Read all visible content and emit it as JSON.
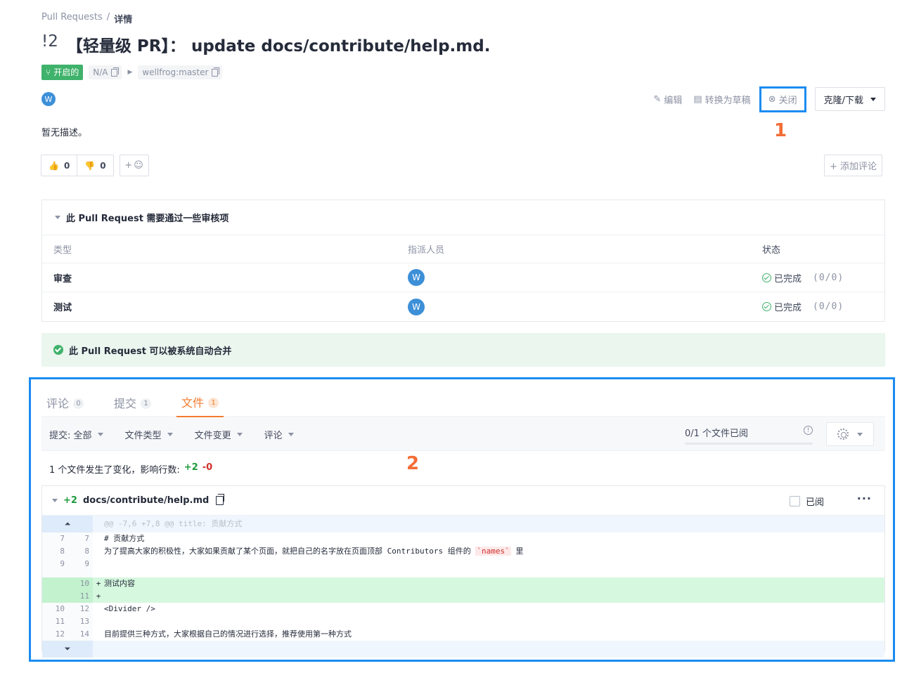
{
  "breadcrumb": {
    "root": "Pull Requests",
    "sep": "/",
    "current": "详情"
  },
  "pr": {
    "number": "!2",
    "title": "【轻量级 PR】： update docs/contribute/help.md.",
    "status": "开启的",
    "source_branch": "N/A",
    "target_branch": "wellfrog:master",
    "author_initial": "W",
    "description": "暂无描述。"
  },
  "actions": {
    "edit": "编辑",
    "draft": "转换为草稿",
    "close": "关闭",
    "clone": "克隆/下载"
  },
  "annotations": {
    "one": "1",
    "two": "2"
  },
  "reactions": {
    "thumbs_up": "0",
    "thumbs_down": "0",
    "add_emoji": "+",
    "add_comment": "+ 添加评论"
  },
  "review": {
    "heading": "此 Pull Request 需要通过一些审核项",
    "columns": [
      "类型",
      "指派人员",
      "状态"
    ],
    "rows": [
      {
        "type": "审查",
        "assignee": "W",
        "status": "已完成",
        "count": "(0/0)"
      },
      {
        "type": "测试",
        "assignee": "W",
        "status": "已完成",
        "count": "(0/0)"
      }
    ]
  },
  "merge_status": "此 Pull Request 可以被系统自动合并",
  "tabs": [
    {
      "label": "评论",
      "count": "0"
    },
    {
      "label": "提交",
      "count": "1"
    },
    {
      "label": "文件",
      "count": "1"
    }
  ],
  "filters": {
    "commit_prefix": "提交:",
    "commit_value": "全部",
    "file_type": "文件类型",
    "file_change": "文件变更",
    "comment": "评论",
    "files_viewed": "0/1 个文件已阅",
    "viewed_fraction": 0
  },
  "summary": {
    "text": "1 个文件发生了变化，影响行数:",
    "added": "+2",
    "removed": "-0"
  },
  "file": {
    "added": "+2",
    "path": "docs/contribute/help.md",
    "viewed_label": "已阅",
    "more": "···",
    "hunk": "@@ -7,6 +7,8 @@ title: 贡献方式",
    "lines": [
      {
        "old": "7",
        "new": "7",
        "sign": "",
        "text": "# 贡献方式",
        "kind": "ctx"
      },
      {
        "old": "8",
        "new": "8",
        "sign": "",
        "text_pre": "为了提高大家的积极性，大家如果贡献了某个页面，就把自己的名字放在页面顶部 Contributors 组件的 ",
        "code": "`names`",
        "text_post": " 里",
        "kind": "ctx"
      },
      {
        "old": "9",
        "new": "9",
        "sign": "",
        "text": "",
        "kind": "ctx"
      },
      {
        "old": "",
        "new": "10",
        "sign": "+",
        "text": "测试内容",
        "kind": "add"
      },
      {
        "old": "",
        "new": "11",
        "sign": "+",
        "text": "",
        "kind": "add"
      },
      {
        "old": "10",
        "new": "12",
        "sign": "",
        "text": "<Divider />",
        "kind": "ctx"
      },
      {
        "old": "11",
        "new": "13",
        "sign": "",
        "text": "",
        "kind": "ctx"
      },
      {
        "old": "12",
        "new": "14",
        "sign": "",
        "text": "目前提供三种方式，大家根据自己的情况进行选择，推荐使用第一种方式",
        "kind": "ctx"
      }
    ]
  },
  "colors": {
    "accent": "#f37b2d",
    "open_green": "#3fb26b",
    "highlight_blue": "#1b8cf0",
    "annotation_orange": "#f36c36"
  }
}
